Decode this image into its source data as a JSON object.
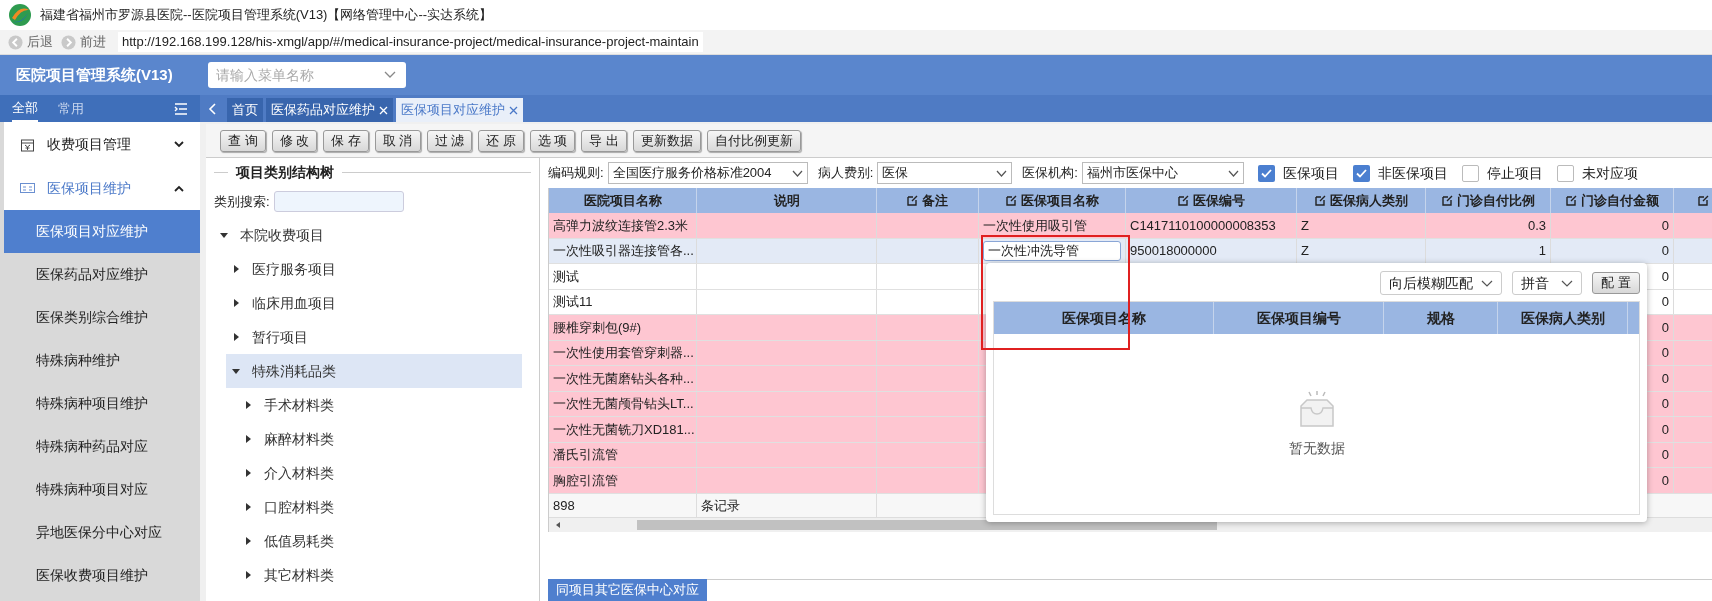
{
  "window": {
    "title": "福建省福州市罗源县医院--医院项目管理系统(V13)【网络管理中心--实达系统】"
  },
  "nav": {
    "back": "后退",
    "forward": "前进",
    "url": "http://192.168.199.128/his-xmgl/app/#/medical-insurance-project/medical-insurance-project-maintain"
  },
  "header": {
    "app_title": "医院项目管理系统(V13)",
    "menu_search": {
      "placeholder": "请输入菜单名称"
    }
  },
  "sidebar": {
    "tabs": [
      {
        "label": "全部",
        "selected": true
      },
      {
        "label": "常用",
        "selected": false
      }
    ],
    "groups": [
      {
        "label": "收费项目管理",
        "expanded": false
      },
      {
        "label": "医保项目维护",
        "expanded": true,
        "children": [
          {
            "label": "医保项目对应维护",
            "selected": true
          },
          {
            "label": "医保药品对应维护",
            "selected": false
          },
          {
            "label": "医保类别综合维护",
            "selected": false
          },
          {
            "label": "特殊病种维护",
            "selected": false
          },
          {
            "label": "特殊病种项目维护",
            "selected": false
          },
          {
            "label": "特殊病种药品对应",
            "selected": false
          },
          {
            "label": "特殊病种项目对应",
            "selected": false
          },
          {
            "label": "异地医保分中心对应",
            "selected": false
          },
          {
            "label": "医保收费项目维护",
            "selected": false
          }
        ]
      }
    ]
  },
  "page_tabs": [
    {
      "label": "首页",
      "closable": false,
      "selected": false
    },
    {
      "label": "医保药品对应维护",
      "closable": true,
      "selected": false
    },
    {
      "label": "医保项目对应维护",
      "closable": true,
      "selected": true
    }
  ],
  "toolbar": [
    "查 询",
    "修 改",
    "保 存",
    "取 消",
    "过 滤",
    "还 原",
    "选 项",
    "导 出",
    "更新数据",
    "自付比例更新"
  ],
  "tree": {
    "title": "项目类别结构树",
    "search_label": "类别搜索:",
    "items": [
      {
        "label": "本院收费项目",
        "expanded": true,
        "selected": false,
        "children": [
          {
            "label": "医疗服务项目",
            "expanded": false,
            "selected": false
          },
          {
            "label": "临床用血项目",
            "expanded": false,
            "selected": false
          },
          {
            "label": "暂行项目",
            "expanded": false,
            "selected": false
          },
          {
            "label": "特殊消耗品类",
            "expanded": true,
            "selected": true,
            "children": [
              {
                "label": "手术材料类",
                "expanded": false,
                "selected": false
              },
              {
                "label": "麻醉材料类",
                "expanded": false,
                "selected": false
              },
              {
                "label": "介入材料类",
                "expanded": false,
                "selected": false
              },
              {
                "label": "口腔材料类",
                "expanded": false,
                "selected": false
              },
              {
                "label": "低值易耗类",
                "expanded": false,
                "selected": false
              },
              {
                "label": "其它材料类",
                "expanded": false,
                "selected": false
              }
            ]
          }
        ]
      }
    ]
  },
  "filters": {
    "selects": [
      {
        "label": "编码规则:",
        "value": "全国医疗服务价格标准2004"
      },
      {
        "label": "病人费别:",
        "value": "医保"
      },
      {
        "label": "医保机构:",
        "value": "福州市医保中心"
      }
    ],
    "checkboxes": [
      {
        "label": "医保项目",
        "checked": true
      },
      {
        "label": "非医保项目",
        "checked": true
      },
      {
        "label": "停止项目",
        "checked": false
      },
      {
        "label": "未对应项",
        "checked": false
      }
    ]
  },
  "table": {
    "columns": [
      {
        "label": "医院项目名称",
        "editable": false,
        "kind": "text"
      },
      {
        "label": "说明",
        "editable": false,
        "kind": "text"
      },
      {
        "label": "备注",
        "editable": true,
        "kind": "text"
      },
      {
        "label": "医保项目名称",
        "editable": true,
        "kind": "text"
      },
      {
        "label": "医保编号",
        "editable": true,
        "kind": "text"
      },
      {
        "label": "医保病人类别",
        "editable": true,
        "kind": "text"
      },
      {
        "label": "门诊自付比例",
        "editable": true,
        "kind": "number"
      },
      {
        "label": "门诊自付金额",
        "editable": true,
        "kind": "number"
      },
      {
        "editable": true,
        "kind": "number"
      }
    ],
    "rows": [
      {
        "flagged": true,
        "selected": false,
        "cells": [
          "高弹力波纹连接管2.3米",
          null,
          null,
          "一次性使用吸引管",
          "C1417110100000008353",
          "Z",
          "0.3",
          "0",
          null
        ]
      },
      {
        "selected": true,
        "editor": {
          "value": "一次性冲洗导管"
        },
        "cells": [
          "一次性吸引器连接管各...",
          null,
          null,
          null,
          "950018000000",
          "Z",
          "1",
          "0",
          null
        ]
      },
      {
        "flagged": false,
        "selected": false,
        "cells": [
          "测试",
          null,
          null,
          null,
          null,
          null,
          null,
          "0",
          null
        ]
      },
      {
        "flagged": false,
        "selected": false,
        "cells": [
          "测试11",
          null,
          null,
          null,
          null,
          null,
          null,
          "0",
          null
        ]
      },
      {
        "flagged": true,
        "selected": false,
        "cells": [
          "腰椎穿刺包(9#)",
          null,
          null,
          null,
          null,
          null,
          null,
          "0",
          null
        ]
      },
      {
        "flagged": true,
        "selected": false,
        "cells": [
          "一次性使用套管穿刺器...",
          null,
          null,
          null,
          null,
          null,
          null,
          "0",
          null
        ]
      },
      {
        "flagged": true,
        "selected": false,
        "cells": [
          "一次性无菌磨钻头各种...",
          null,
          null,
          null,
          null,
          null,
          null,
          "0",
          null
        ]
      },
      {
        "flagged": true,
        "selected": false,
        "cells": [
          "一次性无菌颅骨钻头LT...",
          null,
          null,
          null,
          null,
          null,
          null,
          "0",
          null
        ]
      },
      {
        "flagged": true,
        "selected": false,
        "cells": [
          "一次性无菌铣刀XD181...",
          null,
          null,
          null,
          null,
          null,
          null,
          "0",
          null
        ]
      },
      {
        "flagged": true,
        "selected": false,
        "cells": [
          "潘氏引流管",
          null,
          null,
          null,
          null,
          null,
          null,
          "0",
          null
        ]
      },
      {
        "flagged": true,
        "selected": false,
        "cells": [
          "胸腔引流管",
          null,
          null,
          null,
          null,
          null,
          null,
          "0",
          null
        ]
      }
    ],
    "footer": [
      "898",
      "条记录"
    ]
  },
  "lookup_popup": {
    "match_mode": "向后模糊匹配",
    "input_mode": "拼音",
    "config_button": "配 置",
    "columns": [
      "医保项目名称",
      "医保项目编号",
      "规格",
      "医保病人类别"
    ],
    "empty_text": "暂无数据"
  },
  "bottom_tab": "同项目其它医保中心对应"
}
